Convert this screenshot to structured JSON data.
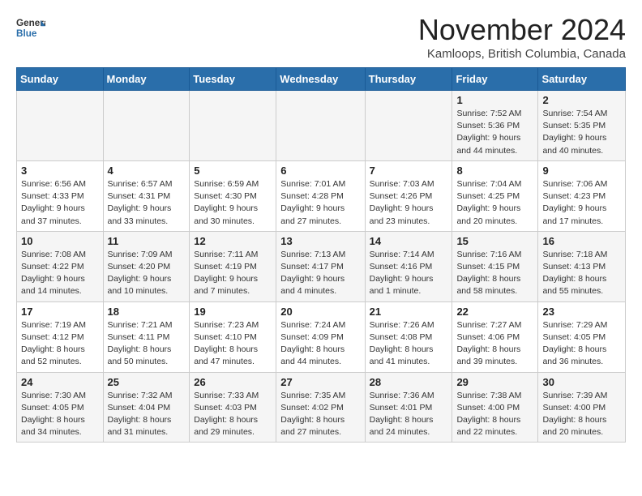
{
  "header": {
    "logo_general": "General",
    "logo_blue": "Blue",
    "month_title": "November 2024",
    "subtitle": "Kamloops, British Columbia, Canada"
  },
  "weekdays": [
    "Sunday",
    "Monday",
    "Tuesday",
    "Wednesday",
    "Thursday",
    "Friday",
    "Saturday"
  ],
  "weeks": [
    [
      {
        "day": "",
        "info": ""
      },
      {
        "day": "",
        "info": ""
      },
      {
        "day": "",
        "info": ""
      },
      {
        "day": "",
        "info": ""
      },
      {
        "day": "",
        "info": ""
      },
      {
        "day": "1",
        "info": "Sunrise: 7:52 AM\nSunset: 5:36 PM\nDaylight: 9 hours and 44 minutes."
      },
      {
        "day": "2",
        "info": "Sunrise: 7:54 AM\nSunset: 5:35 PM\nDaylight: 9 hours and 40 minutes."
      }
    ],
    [
      {
        "day": "3",
        "info": "Sunrise: 6:56 AM\nSunset: 4:33 PM\nDaylight: 9 hours and 37 minutes."
      },
      {
        "day": "4",
        "info": "Sunrise: 6:57 AM\nSunset: 4:31 PM\nDaylight: 9 hours and 33 minutes."
      },
      {
        "day": "5",
        "info": "Sunrise: 6:59 AM\nSunset: 4:30 PM\nDaylight: 9 hours and 30 minutes."
      },
      {
        "day": "6",
        "info": "Sunrise: 7:01 AM\nSunset: 4:28 PM\nDaylight: 9 hours and 27 minutes."
      },
      {
        "day": "7",
        "info": "Sunrise: 7:03 AM\nSunset: 4:26 PM\nDaylight: 9 hours and 23 minutes."
      },
      {
        "day": "8",
        "info": "Sunrise: 7:04 AM\nSunset: 4:25 PM\nDaylight: 9 hours and 20 minutes."
      },
      {
        "day": "9",
        "info": "Sunrise: 7:06 AM\nSunset: 4:23 PM\nDaylight: 9 hours and 17 minutes."
      }
    ],
    [
      {
        "day": "10",
        "info": "Sunrise: 7:08 AM\nSunset: 4:22 PM\nDaylight: 9 hours and 14 minutes."
      },
      {
        "day": "11",
        "info": "Sunrise: 7:09 AM\nSunset: 4:20 PM\nDaylight: 9 hours and 10 minutes."
      },
      {
        "day": "12",
        "info": "Sunrise: 7:11 AM\nSunset: 4:19 PM\nDaylight: 9 hours and 7 minutes."
      },
      {
        "day": "13",
        "info": "Sunrise: 7:13 AM\nSunset: 4:17 PM\nDaylight: 9 hours and 4 minutes."
      },
      {
        "day": "14",
        "info": "Sunrise: 7:14 AM\nSunset: 4:16 PM\nDaylight: 9 hours and 1 minute."
      },
      {
        "day": "15",
        "info": "Sunrise: 7:16 AM\nSunset: 4:15 PM\nDaylight: 8 hours and 58 minutes."
      },
      {
        "day": "16",
        "info": "Sunrise: 7:18 AM\nSunset: 4:13 PM\nDaylight: 8 hours and 55 minutes."
      }
    ],
    [
      {
        "day": "17",
        "info": "Sunrise: 7:19 AM\nSunset: 4:12 PM\nDaylight: 8 hours and 52 minutes."
      },
      {
        "day": "18",
        "info": "Sunrise: 7:21 AM\nSunset: 4:11 PM\nDaylight: 8 hours and 50 minutes."
      },
      {
        "day": "19",
        "info": "Sunrise: 7:23 AM\nSunset: 4:10 PM\nDaylight: 8 hours and 47 minutes."
      },
      {
        "day": "20",
        "info": "Sunrise: 7:24 AM\nSunset: 4:09 PM\nDaylight: 8 hours and 44 minutes."
      },
      {
        "day": "21",
        "info": "Sunrise: 7:26 AM\nSunset: 4:08 PM\nDaylight: 8 hours and 41 minutes."
      },
      {
        "day": "22",
        "info": "Sunrise: 7:27 AM\nSunset: 4:06 PM\nDaylight: 8 hours and 39 minutes."
      },
      {
        "day": "23",
        "info": "Sunrise: 7:29 AM\nSunset: 4:05 PM\nDaylight: 8 hours and 36 minutes."
      }
    ],
    [
      {
        "day": "24",
        "info": "Sunrise: 7:30 AM\nSunset: 4:05 PM\nDaylight: 8 hours and 34 minutes."
      },
      {
        "day": "25",
        "info": "Sunrise: 7:32 AM\nSunset: 4:04 PM\nDaylight: 8 hours and 31 minutes."
      },
      {
        "day": "26",
        "info": "Sunrise: 7:33 AM\nSunset: 4:03 PM\nDaylight: 8 hours and 29 minutes."
      },
      {
        "day": "27",
        "info": "Sunrise: 7:35 AM\nSunset: 4:02 PM\nDaylight: 8 hours and 27 minutes."
      },
      {
        "day": "28",
        "info": "Sunrise: 7:36 AM\nSunset: 4:01 PM\nDaylight: 8 hours and 24 minutes."
      },
      {
        "day": "29",
        "info": "Sunrise: 7:38 AM\nSunset: 4:00 PM\nDaylight: 8 hours and 22 minutes."
      },
      {
        "day": "30",
        "info": "Sunrise: 7:39 AM\nSunset: 4:00 PM\nDaylight: 8 hours and 20 minutes."
      }
    ]
  ]
}
